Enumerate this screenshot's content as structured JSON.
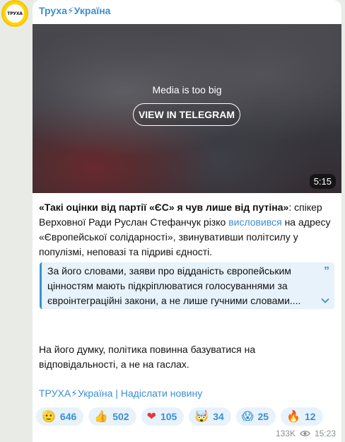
{
  "avatar": {
    "text": "ТРУХА"
  },
  "channel": {
    "name": "Труха⚡Україна"
  },
  "media": {
    "notice": "Media is too big",
    "button_label": "VIEW IN TELEGRAM",
    "duration": "5:15"
  },
  "post": {
    "p1_bold": "«Такі оцінки від партії «ЄС» я чув лише від путіна»",
    "p1_a": ": спікер Верховної Ради Руслан Стефанчук різко ",
    "p1_link": "висловився",
    "p1_b": " на адресу «Європейської солідарності», звинувативши політсилу у популізмі, неповазі та підриві єдності.",
    "quote": "За його словами, заяви про відданість європейським цінностям мають підкріплюватися голосуваннями за євроінтеграційні закони, а не лише гучними словами....",
    "p2": "На його думку, політика повинна базуватися на відповідальності, а не на гаслах.",
    "footer_link": "ТРУХА⚡Україна | Надіслати новину"
  },
  "reactions": [
    {
      "emoji": "🫡",
      "count": "646"
    },
    {
      "emoji": "👍",
      "count": "502"
    },
    {
      "emoji": "❤",
      "count": "105"
    },
    {
      "emoji": "🤯",
      "count": "34"
    },
    {
      "emoji": "😱",
      "count": "25"
    },
    {
      "emoji": "🔥",
      "count": "12"
    }
  ],
  "meta": {
    "views": "133K",
    "time": "15:23"
  },
  "colors": {
    "accent": "#3a8fd1",
    "quote_bg": "#e8f2fb",
    "background": "#e8ebe6"
  }
}
